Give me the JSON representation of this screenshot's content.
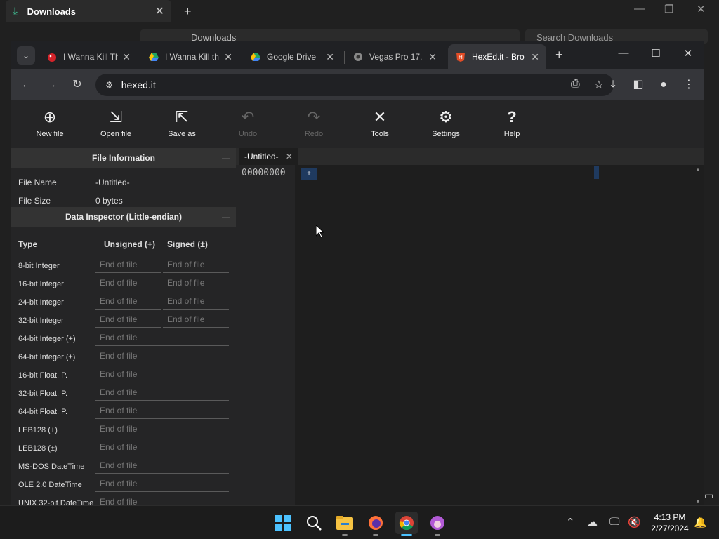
{
  "explorer": {
    "tab_title": "Downloads",
    "address": "Downloads",
    "search_placeholder": "Search Downloads"
  },
  "browser": {
    "tabs": [
      {
        "title": "I Wanna Kill Th",
        "favicon": "red-apple-icon"
      },
      {
        "title": "I Wanna Kill th",
        "favicon": "google-drive-icon"
      },
      {
        "title": "Google Drive",
        "favicon": "google-drive-icon"
      },
      {
        "title": "Vegas Pro 17,",
        "favicon": "vegas-icon"
      },
      {
        "title": "HexEd.it - Bro",
        "favicon": "hexed-icon",
        "active": true
      }
    ],
    "url": "hexed.it"
  },
  "app": {
    "ribbon": {
      "new_file": "New file",
      "open_file": "Open file",
      "save_as": "Save as",
      "undo": "Undo",
      "redo": "Redo",
      "tools": "Tools",
      "settings": "Settings",
      "help": "Help"
    },
    "file_info": {
      "heading": "File Information",
      "name_label": "File Name",
      "name_value": "-Untitled-",
      "size_label": "File Size",
      "size_value": "0 bytes"
    },
    "inspector": {
      "heading": "Data Inspector (Little-endian)",
      "col_type": "Type",
      "col_unsigned": "Unsigned (+)",
      "col_signed": "Signed (±)",
      "empty": "End of file",
      "rows": [
        {
          "label": "8-bit Integer",
          "two": true
        },
        {
          "label": "16-bit Integer",
          "two": true
        },
        {
          "label": "24-bit Integer",
          "two": true
        },
        {
          "label": "32-bit Integer",
          "two": true
        },
        {
          "label": "64-bit Integer (+)",
          "two": false
        },
        {
          "label": "64-bit Integer (±)",
          "two": false
        },
        {
          "label": "16-bit Float. P.",
          "two": false
        },
        {
          "label": "32-bit Float. P.",
          "two": false
        },
        {
          "label": "64-bit Float. P.",
          "two": false
        },
        {
          "label": "LEB128 (+)",
          "two": false
        },
        {
          "label": "LEB128 (±)",
          "two": false
        },
        {
          "label": "MS-DOS DateTime",
          "two": false
        },
        {
          "label": "OLE 2.0 DateTime",
          "two": false
        },
        {
          "label": "UNIX 32-bit DateTime",
          "two": false
        }
      ]
    },
    "editor": {
      "tab": "-Untitled-",
      "offset": "00000000",
      "cursor": "+"
    }
  },
  "taskbar": {
    "time": "4:13 PM",
    "date": "2/27/2024"
  }
}
